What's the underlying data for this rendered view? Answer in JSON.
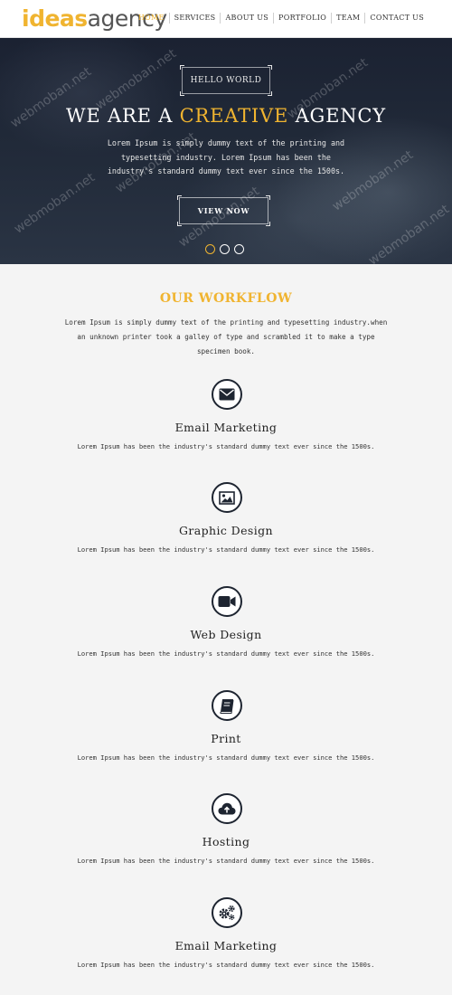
{
  "logo": {
    "bold": "ideas",
    "normal": "agency"
  },
  "nav": {
    "items": [
      {
        "label": "HOME",
        "active": true
      },
      {
        "label": "SERVICES",
        "active": false
      },
      {
        "label": "ABOUT US",
        "active": false
      },
      {
        "label": "PORTFOLIO",
        "active": false
      },
      {
        "label": "TEAM",
        "active": false
      },
      {
        "label": "CONTACT US",
        "active": false
      }
    ]
  },
  "hero": {
    "tag": "HELLO WORLD",
    "title_prefix": "WE ARE A",
    "title_accent": "CREATIVE",
    "title_suffix": "AGENCY",
    "text": "Lorem Ipsum is simply dummy text of the printing and typesetting industry. Lorem Ipsum has been the industry's standard dummy text ever since the 1500s.",
    "button_label": "VIEW NOW",
    "slides": 3,
    "active_slide": 1
  },
  "watermark": "webmoban.net",
  "workflow": {
    "title": "OUR WORKFLOW",
    "intro": "Lorem Ipsum is simply dummy text of the printing and typesetting industry.when an unknown printer took a galley of type and scrambled it to make a type specimen book.",
    "services": [
      {
        "icon": "envelope-icon",
        "title": "Email Marketing",
        "text": "Lorem Ipsum has been the industry's standard dummy text ever since the 1500s."
      },
      {
        "icon": "image-icon",
        "title": "Graphic Design",
        "text": "Lorem Ipsum has been the industry's standard dummy text ever since the 1500s."
      },
      {
        "icon": "video-camera-icon",
        "title": "Web Design",
        "text": "Lorem Ipsum has been the industry's standard dummy text ever since the 1500s."
      },
      {
        "icon": "book-icon",
        "title": "Print",
        "text": "Lorem Ipsum has been the industry's standard dummy text ever since the 1500s."
      },
      {
        "icon": "cloud-upload-icon",
        "title": "Hosting",
        "text": "Lorem Ipsum has been the industry's standard dummy text ever since the 1500s."
      },
      {
        "icon": "gears-icon",
        "title": "Email Marketing",
        "text": "Lorem Ipsum has been the industry's standard dummy text ever since the 1500s."
      }
    ]
  },
  "colors": {
    "accent": "#f0b430",
    "dark": "#1e2531",
    "background": "#f4f4f4"
  }
}
